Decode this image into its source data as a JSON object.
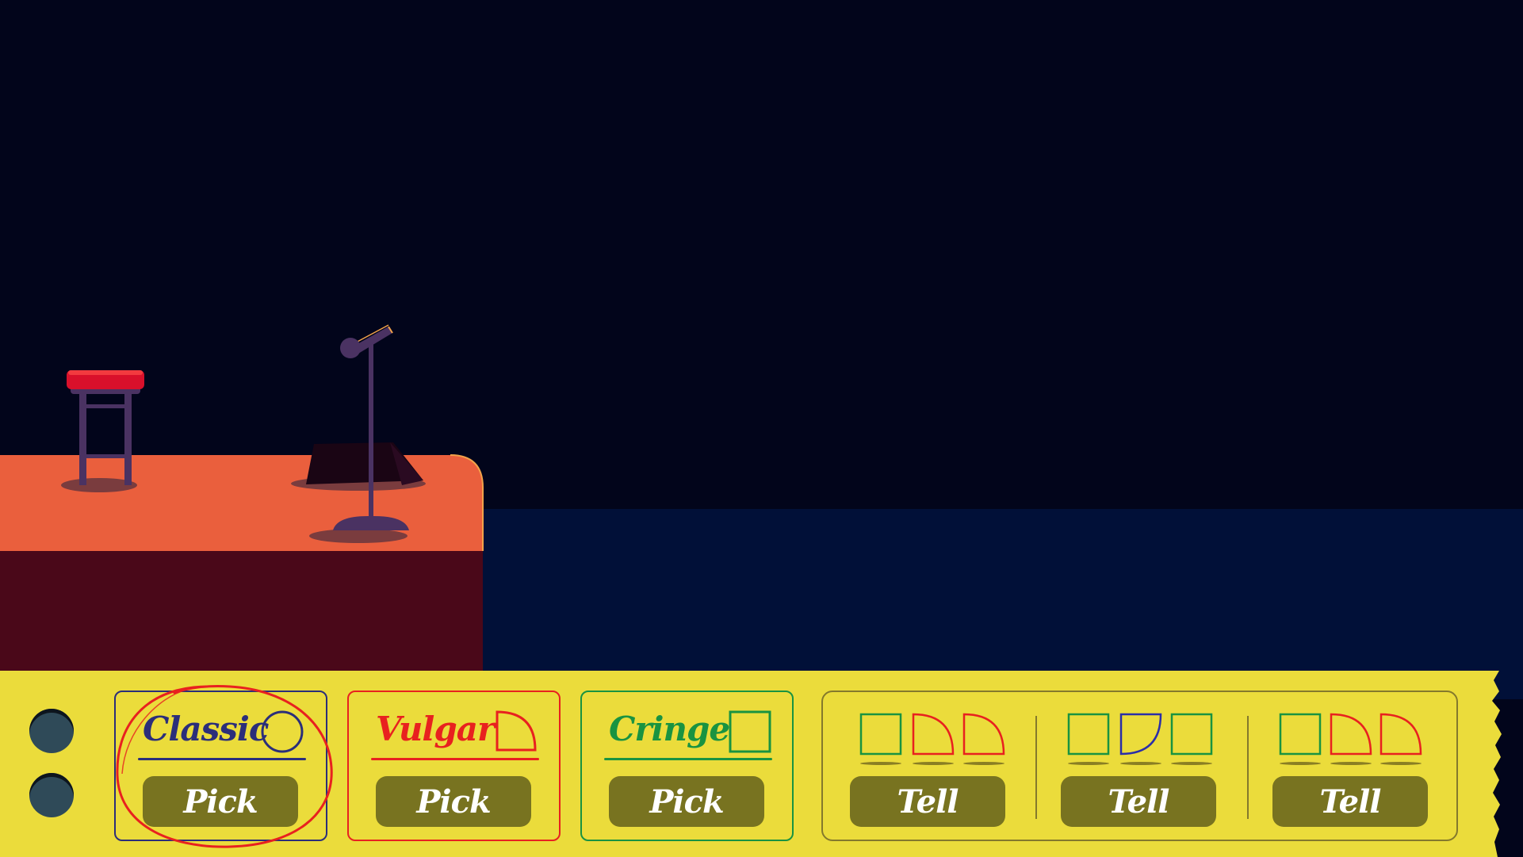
{
  "colors": {
    "sky": "#02051b",
    "floor": "#011038",
    "stage_top": "#ea5f3d",
    "stage_front": "#4a0819",
    "panel": "#ebdc3b",
    "button": "#787320",
    "classic": "#2b2e7a",
    "vulgar": "#e8211f",
    "cringe": "#199341",
    "highlight_circle": "#e8211f"
  },
  "categories": [
    {
      "title": "Classic",
      "shape": "circle-icon",
      "button_label": "Pick",
      "selected": true
    },
    {
      "title": "Vulgar",
      "shape": "quarter-circle-icon",
      "button_label": "Pick",
      "selected": false
    },
    {
      "title": "Cringe",
      "shape": "square-icon",
      "button_label": "Pick",
      "selected": false
    }
  ],
  "jokes": [
    {
      "shapes": [
        "cringe-square",
        "vulgar-quarter",
        "vulgar-quarter"
      ],
      "button_label": "Tell"
    },
    {
      "shapes": [
        "cringe-square",
        "classic-quarter",
        "cringe-square"
      ],
      "button_label": "Tell"
    },
    {
      "shapes": [
        "cringe-square",
        "vulgar-quarter",
        "vulgar-quarter"
      ],
      "button_label": "Tell"
    }
  ]
}
